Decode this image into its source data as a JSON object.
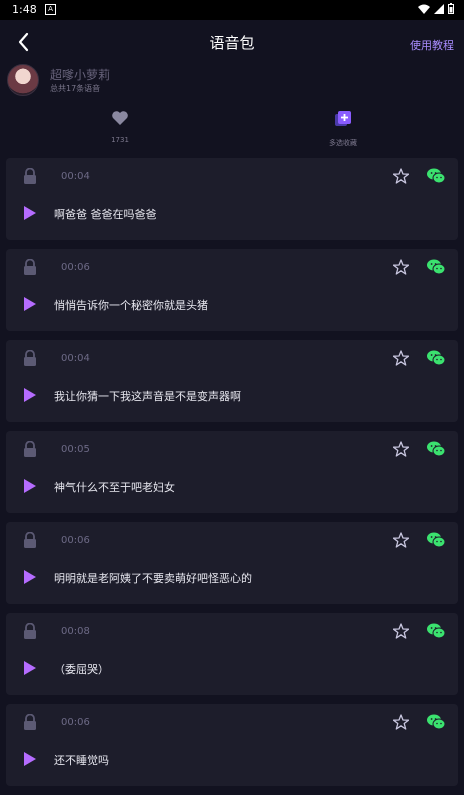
{
  "status_bar": {
    "time": "1:48",
    "notification_letter": "A"
  },
  "app_bar": {
    "title": "语音包",
    "tutorial": "使用教程"
  },
  "profile": {
    "name": "超嗲小萝莉",
    "count": "总共17条语音"
  },
  "actions": {
    "like_count": "1731",
    "multi_select": "多选收藏"
  },
  "colors": {
    "accent": "#a98dff",
    "play": "#b56cff",
    "wechat": "#3be26f",
    "card": "#1d1d2b"
  },
  "voices": [
    {
      "duration": "00:04",
      "text": "啊爸爸 爸爸在吗爸爸"
    },
    {
      "duration": "00:06",
      "text": "悄悄告诉你一个秘密你就是头猪"
    },
    {
      "duration": "00:04",
      "text": "我让你猜一下我这声音是不是变声器啊"
    },
    {
      "duration": "00:05",
      "text": "神气什么不至于吧老妇女"
    },
    {
      "duration": "00:06",
      "text": "明明就是老阿姨了不要卖萌好吧怪恶心的"
    },
    {
      "duration": "00:08",
      "text": "（委屈哭）"
    },
    {
      "duration": "00:06",
      "text": "还不睡觉吗"
    }
  ]
}
